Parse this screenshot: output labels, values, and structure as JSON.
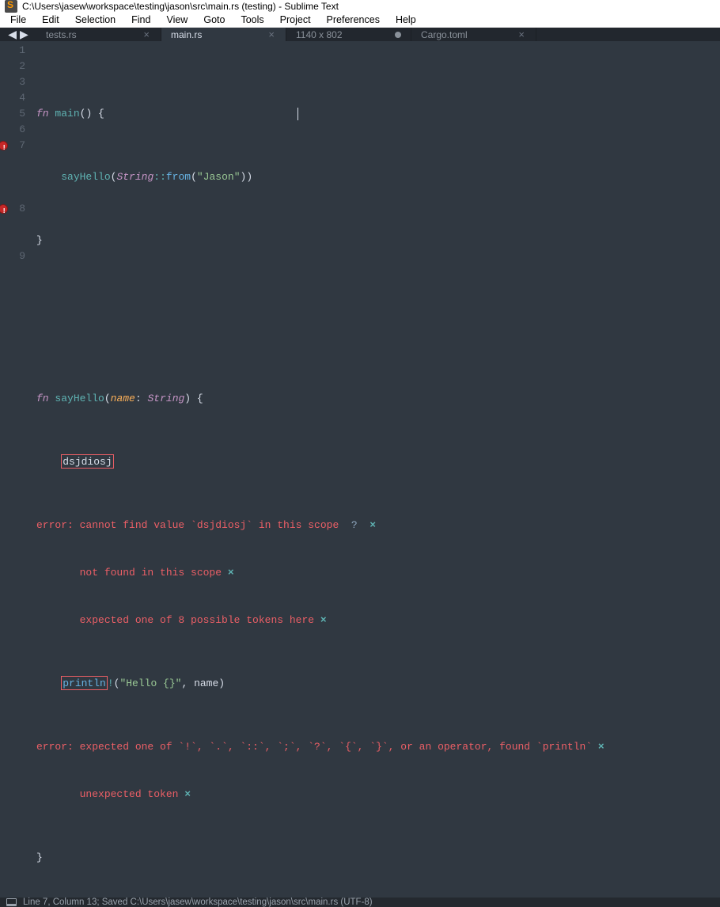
{
  "title": "C:\\Users\\jasew\\workspace\\testing\\jason\\src\\main.rs (testing) - Sublime Text",
  "menu": [
    "File",
    "Edit",
    "Selection",
    "Find",
    "View",
    "Goto",
    "Tools",
    "Project",
    "Preferences",
    "Help"
  ],
  "nav": {
    "back": "◀",
    "fwd": "▶"
  },
  "tabs": [
    {
      "label": "tests.rs",
      "dirty": false,
      "active": false
    },
    {
      "label": "main.rs",
      "dirty": false,
      "active": true
    },
    {
      "label": "1140 x 802",
      "dirty": true,
      "active": false
    },
    {
      "label": "Cargo.toml",
      "dirty": false,
      "active": false
    }
  ],
  "gutter": {
    "lines": [
      "1",
      "2",
      "3",
      "4",
      "5",
      "6",
      "7",
      "",
      "",
      "",
      "8",
      "",
      "",
      "9"
    ],
    "errors": {
      "6": true,
      "10": true
    }
  },
  "code": {
    "l1": {
      "fn": "fn",
      "name": "main",
      "parens": "()",
      "brace": " {"
    },
    "l2": {
      "indent": "    ",
      "call": "sayHello",
      "lp": "(",
      "typ": "String",
      "dcol": "::",
      "from": "from",
      "lp2": "(",
      "str": "\"Jason\"",
      "rp2": ")",
      "rp": ")"
    },
    "l3": {
      "brace": "}"
    },
    "l6": {
      "fn": "fn",
      "name": "sayHello",
      "lp": "(",
      "param": "name",
      "colon": ": ",
      "typ": "String",
      "rp": ")",
      "brace": " {"
    },
    "l7": {
      "indent": "    ",
      "boxed": "dsjdiosj"
    },
    "l7e": {
      "a": "error: cannot find value `dsjdiosj` in this scope",
      "q": "  ?  ",
      "x": "×"
    },
    "l7e2": {
      "indent": "       ",
      "a": "not found in this scope ",
      "x": "×"
    },
    "l7e3": {
      "indent": "       ",
      "a": "expected one of 8 possible tokens here ",
      "x": "×"
    },
    "l8": {
      "indent": "    ",
      "boxed": "println",
      "bang": "!",
      "lp": "(",
      "str": "\"Hello {}\"",
      "comma": ", ",
      "var": "name",
      "rp": ")"
    },
    "l8e": {
      "a": "error: expected one of `!`, `.`, `::`, `;`, `?`, `{`, `}`, or an operator, found `println` ",
      "x": "×"
    },
    "l8e2": {
      "indent": "       ",
      "a": "unexpected token ",
      "x": "×"
    },
    "l9": {
      "brace": "}"
    }
  },
  "status": {
    "text": "Line 7, Column 13; Saved C:\\Users\\jasew\\workspace\\testing\\jason\\src\\main.rs (UTF-8)"
  }
}
